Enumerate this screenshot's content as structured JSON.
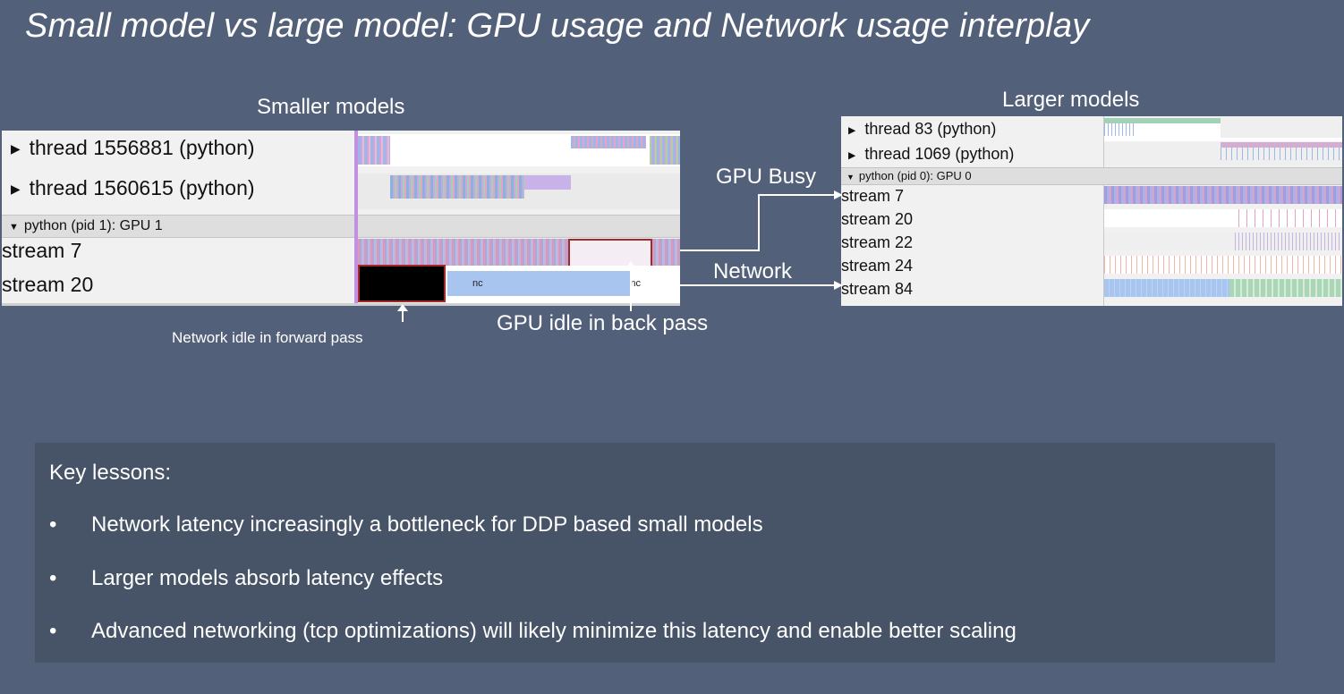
{
  "slide": {
    "title": "Small model vs large model: GPU usage and Network usage interplay"
  },
  "small": {
    "heading": "Smaller models",
    "threads": [
      "thread 1556881 (python)",
      "thread 1560615 (python)"
    ],
    "gpu_header": "python (pid 1): GPU 1",
    "streams": [
      "stream 7",
      "stream 20"
    ],
    "kernel_label": "nc"
  },
  "large": {
    "heading": "Larger models",
    "threads": [
      "thread 83 (python)",
      "thread 1069 (python)"
    ],
    "gpu_header": "python (pid 0): GPU 0",
    "streams": [
      "stream 7",
      "stream 20",
      "stream 22",
      "stream 24",
      "stream 84"
    ]
  },
  "annotations": {
    "gpu_busy": "GPU Busy",
    "network": "Network",
    "network_idle": "Network idle in forward pass",
    "gpu_idle": "GPU idle in back pass"
  },
  "lessons": {
    "heading": "Key lessons:",
    "bullet": "•",
    "items": [
      "Network latency increasingly a bottleneck for DDP based small models",
      "Larger models absorb latency effects",
      "Advanced networking (tcp optimizations) will likely minimize this latency and enable better scaling"
    ]
  },
  "colors": {
    "background": "#536079",
    "box": "#475467",
    "trace_blue": "#a7c5ee",
    "highlight_red": "#a32a2a"
  }
}
